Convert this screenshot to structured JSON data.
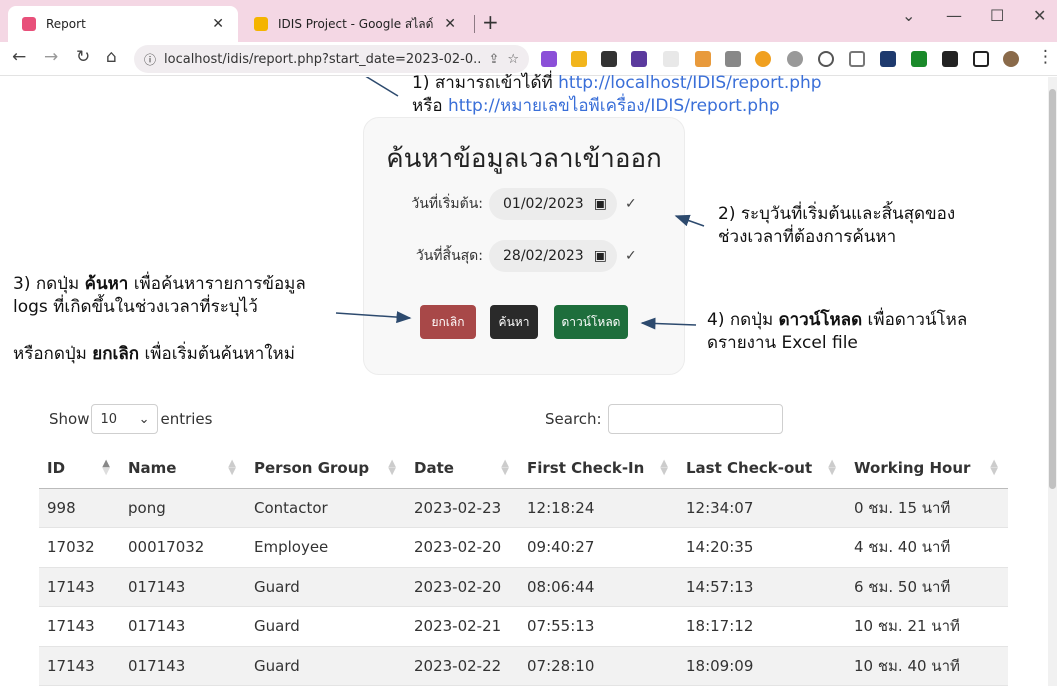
{
  "browser": {
    "tabs": [
      {
        "title": "Report",
        "active": true,
        "color": "#e8507a"
      },
      {
        "title": "IDIS Project - Google สไลด์",
        "active": false,
        "color": "#f4b400"
      }
    ],
    "url": "localhost/idis/report.php?start_date=2023-02-0..."
  },
  "annotations": {
    "a1_prefix": "1) สามารถเข้าได้ที่ ",
    "a1_link": "http://localhost/IDIS/report.php",
    "a1_or": "หรือ ",
    "a1_link2": "http://หมายเลขไอพีเครื่อง/IDIS/report.php",
    "a2_line1": "2) ระบุวันที่เริ่มต้นและสิ้นสุดของ",
    "a2_line2": "ช่วงเวลาที่ต้องการค้นหา",
    "a3_pre": "3) กดปุ่ม ",
    "a3_bold": "ค้นหา",
    "a3_post": " เพื่อค้นหารายการข้อมูล",
    "a3_line2": "logs ที่เกิดขึ้นในช่วงเวลาที่ระบุไว้",
    "a3b_pre": "หรือกดปุ่ม ",
    "a3b_bold": "ยกเลิก",
    "a3b_post": " เพื่อเริ่มต้นค้นหาใหม่",
    "a4_pre": "4) กดปุ่ม ",
    "a4_bold": "ดาวน์โหลด",
    "a4_post": " เพื่อดาวน์โหล",
    "a4_line2": "ดรายงาน Excel file"
  },
  "form": {
    "title": "ค้นหาข้อมูลเวลาเข้าออก",
    "start_label": "วันที่เริ่มต้น:",
    "start_value": "01/02/2023",
    "end_label": "วันที่สิ้นสุด:",
    "end_value": "28/02/2023",
    "check": "✓",
    "cancel_label": "ยกเลิก",
    "search_label": "ค้นหา",
    "download_label": "ดาวน์โหลด"
  },
  "datatable": {
    "show_label": "Show",
    "length_value": "10",
    "entries_label": "entries",
    "search_label": "Search:",
    "columns": [
      "ID",
      "Name",
      "Person Group",
      "Date",
      "First Check-In",
      "Last Check-out",
      "Working Hour"
    ],
    "rows": [
      [
        "998",
        "pong",
        "Contactor",
        "2023-02-23",
        "12:18:24",
        "12:34:07",
        "0 ชม. 15 นาที"
      ],
      [
        "17032",
        "00017032",
        "Employee",
        "2023-02-20",
        "09:40:27",
        "14:20:35",
        "4 ชม. 40 นาที"
      ],
      [
        "17143",
        "017143",
        "Guard",
        "2023-02-20",
        "08:06:44",
        "14:57:13",
        "6 ชม. 50 นาที"
      ],
      [
        "17143",
        "017143",
        "Guard",
        "2023-02-21",
        "07:55:13",
        "18:17:12",
        "10 ชม. 21 นาที"
      ],
      [
        "17143",
        "017143",
        "Guard",
        "2023-02-22",
        "07:28:10",
        "18:09:09",
        "10 ชม. 40 นาที"
      ]
    ]
  },
  "colors": {
    "cancel": "#a84848",
    "search": "#2a2a2a",
    "download": "#1e6e3c",
    "link": "#3a6fd8",
    "tabbar": "#f4d7e4"
  }
}
